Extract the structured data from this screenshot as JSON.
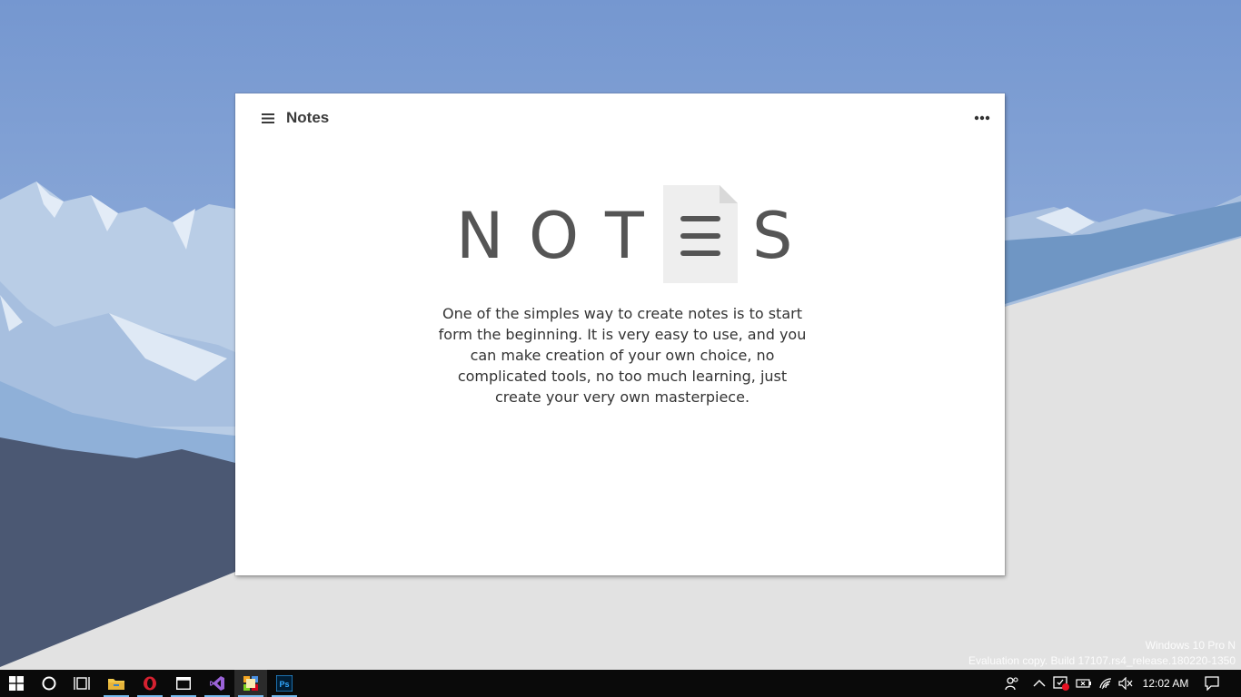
{
  "window": {
    "title": "Notes",
    "logo_letters": [
      "N",
      "O",
      "T",
      "S"
    ],
    "description": "One of the simples way to create notes is to start form the beginning. It is very easy to use, and you can make creation of your own choice, no complicated tools, no too much learning, just create your very own masterpiece."
  },
  "watermark": {
    "line1": "Windows 10 Pro N",
    "line2": "Evaluation copy. Build 17107.rs4_release.180220-1350"
  },
  "taskbar": {
    "apps": [
      {
        "name": "start-icon"
      },
      {
        "name": "cortana-icon"
      },
      {
        "name": "task-view-icon"
      },
      {
        "name": "file-explorer-icon"
      },
      {
        "name": "opera-icon"
      },
      {
        "name": "window-app-icon"
      },
      {
        "name": "visual-studio-icon"
      },
      {
        "name": "notes-app-icon"
      },
      {
        "name": "photoshop-icon",
        "label": "Ps"
      }
    ],
    "clock": "12:02 AM"
  },
  "colors": {
    "sky": "#7d9fd3",
    "taskbar": "#0a0a0a",
    "accent": "#76b9ed",
    "logo": "#555555"
  }
}
